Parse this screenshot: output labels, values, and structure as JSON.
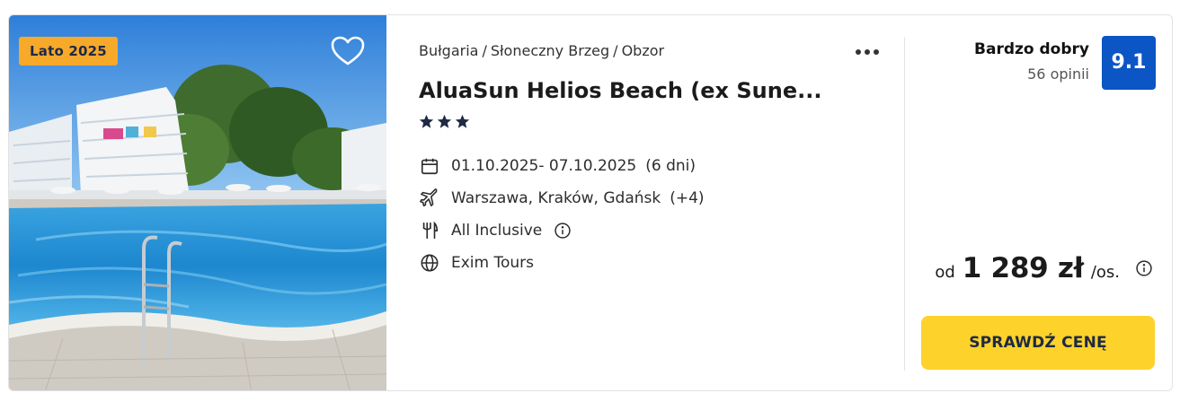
{
  "photo": {
    "badge": "Lato 2025"
  },
  "breadcrumb": {
    "country": "Bułgaria",
    "region": "Słoneczny Brzeg",
    "city": "Obzor",
    "separator": "/"
  },
  "hotel": {
    "name": "AluaSun Helios Beach (ex Sune...",
    "stars": 3
  },
  "details": {
    "dates": "01.10.2025- 07.10.2025",
    "duration": "(6 dni)",
    "departure": "Warszawa, Kraków, Gdańsk",
    "departure_more": "(+4)",
    "board": "All Inclusive",
    "operator": "Exim Tours"
  },
  "rating": {
    "label": "Bardzo dobry",
    "count": "56 opinii",
    "score": "9.1"
  },
  "price": {
    "prefix": "od",
    "value": "1 289 zł",
    "suffix": "/os."
  },
  "cta": {
    "label": "SPRAWDŹ CENĘ"
  },
  "icons": {
    "favorite": "heart-icon",
    "more": "more-dots-icon",
    "star": "star-icon",
    "calendar": "calendar-icon",
    "plane": "plane-icon",
    "board": "cutlery-icon",
    "operator": "globe-icon",
    "info": "info-icon"
  },
  "colors": {
    "badge_bg": "#f7a92a",
    "score_bg": "#0b55c5",
    "cta_bg": "#fdd22a",
    "star": "#1f2a44"
  }
}
